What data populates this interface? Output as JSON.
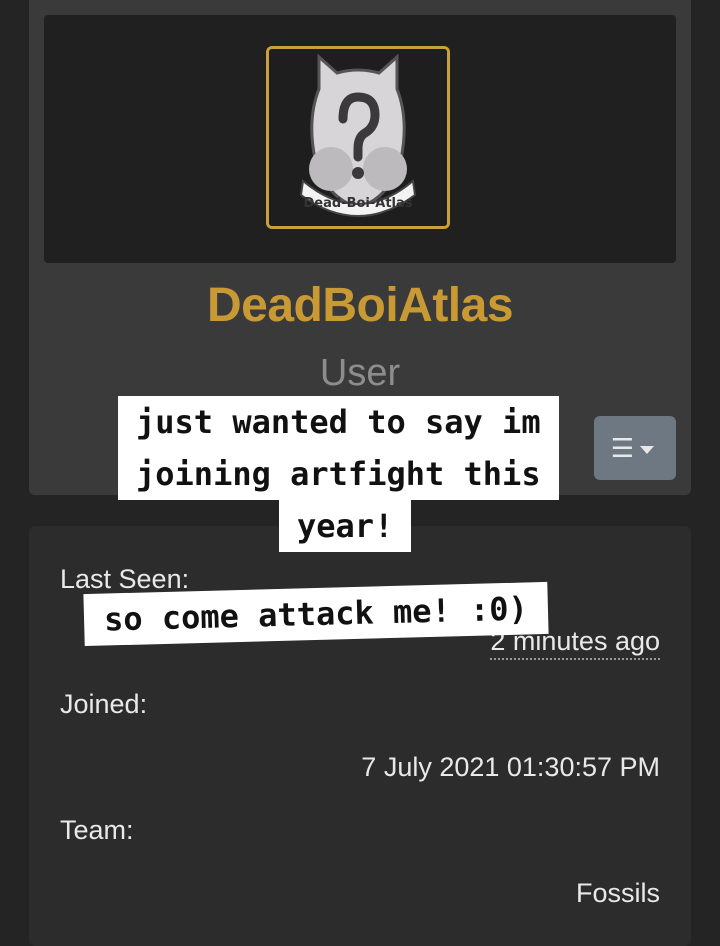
{
  "profile": {
    "username": "DeadBoiAtlas",
    "role": "User",
    "avatar_text": "Dead-Boi-Atlas",
    "menu_icon": "hamburger-menu-icon",
    "accent_color": "#c99a34"
  },
  "details": {
    "last_seen_label": "Last Seen:",
    "last_seen_value": "2 minutes ago",
    "joined_label": "Joined:",
    "joined_value": "7 July 2021 01:30:57 PM",
    "team_label": "Team:",
    "team_value": "Fossils"
  },
  "overlay": {
    "line1": "just wanted to say im",
    "line2": "joining artfight this",
    "line3": "year!",
    "line4": "so come attack me! :0)"
  }
}
